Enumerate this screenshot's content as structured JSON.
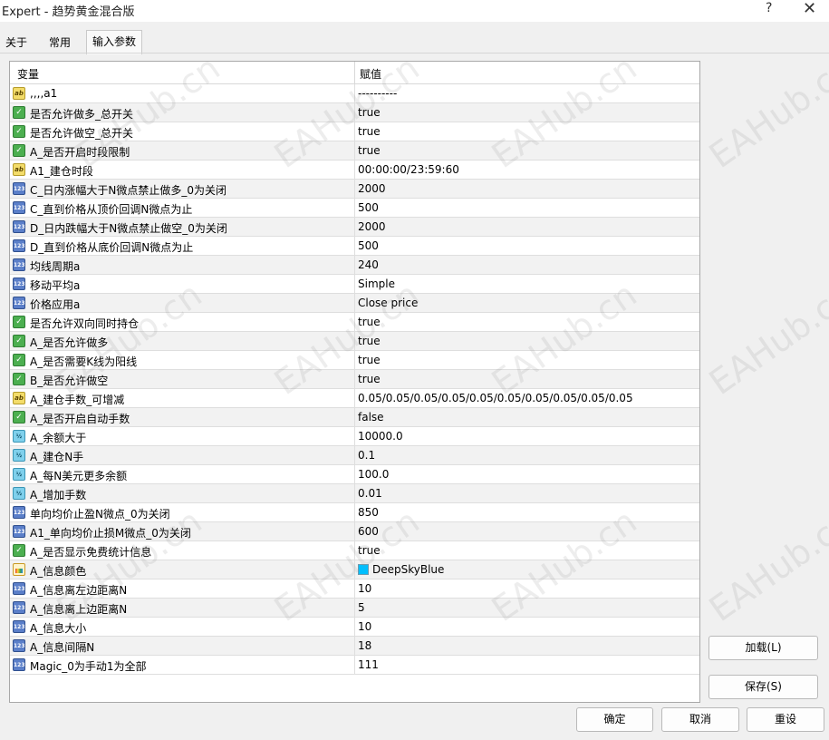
{
  "window": {
    "title": "Expert - 趋势黄金混合版",
    "help_glyph": "?",
    "close_glyph": "✕"
  },
  "tabs": [
    {
      "label": "关于"
    },
    {
      "label": "常用"
    },
    {
      "label": "输入参数",
      "active": true
    }
  ],
  "table": {
    "headers": {
      "variable": "变量",
      "value": "赋值"
    },
    "rows": [
      {
        "type": "string",
        "name": ",,,,a1",
        "value": "----------"
      },
      {
        "type": "bool",
        "name": "是否允许做多_总开关",
        "value": "true"
      },
      {
        "type": "bool",
        "name": "是否允许做空_总开关",
        "value": "true"
      },
      {
        "type": "bool",
        "name": "A_是否开启时段限制",
        "value": "true"
      },
      {
        "type": "string",
        "name": "A1_建仓时段",
        "value": "00:00:00/23:59:60"
      },
      {
        "type": "int",
        "name": "C_日内涨幅大于N微点禁止做多_0为关闭",
        "value": "2000"
      },
      {
        "type": "int",
        "name": "C_直到价格从顶价回调N微点为止",
        "value": "500"
      },
      {
        "type": "int",
        "name": "D_日内跌幅大于N微点禁止做空_0为关闭",
        "value": "2000"
      },
      {
        "type": "int",
        "name": "D_直到价格从底价回调N微点为止",
        "value": "500"
      },
      {
        "type": "int",
        "name": "均线周期a",
        "value": "240"
      },
      {
        "type": "int",
        "name": "移动平均a",
        "value": "Simple"
      },
      {
        "type": "int",
        "name": "价格应用a",
        "value": "Close price"
      },
      {
        "type": "bool",
        "name": "是否允许双向同时持仓",
        "value": "true"
      },
      {
        "type": "bool",
        "name": "A_是否允许做多",
        "value": "true"
      },
      {
        "type": "bool",
        "name": "A_是否需要K线为阳线",
        "value": "true"
      },
      {
        "type": "bool",
        "name": "B_是否允许做空",
        "value": "true"
      },
      {
        "type": "string",
        "name": "A_建仓手数_可增减",
        "value": "0.05/0.05/0.05/0.05/0.05/0.05/0.05/0.05/0.05/0.05"
      },
      {
        "type": "bool",
        "name": "A_是否开启自动手数",
        "value": "false"
      },
      {
        "type": "double",
        "name": "A_余额大于",
        "value": "10000.0"
      },
      {
        "type": "double",
        "name": "A_建仓N手",
        "value": "0.1"
      },
      {
        "type": "double",
        "name": "A_每N美元更多余额",
        "value": "100.0"
      },
      {
        "type": "double",
        "name": "A_增加手数",
        "value": "0.01"
      },
      {
        "type": "int",
        "name": "单向均价止盈N微点_0为关闭",
        "value": "850"
      },
      {
        "type": "int",
        "name": "A1_单向均价止损M微点_0为关闭",
        "value": "600"
      },
      {
        "type": "bool",
        "name": "A_是否显示免费统计信息",
        "value": "true"
      },
      {
        "type": "color",
        "name": "A_信息颜色",
        "value": "DeepSkyBlue",
        "swatch": "#00bfff"
      },
      {
        "type": "int",
        "name": "A_信息离左边距离N",
        "value": "10"
      },
      {
        "type": "int",
        "name": "A_信息离上边距离N",
        "value": "5"
      },
      {
        "type": "int",
        "name": "A_信息大小",
        "value": "10"
      },
      {
        "type": "int",
        "name": "A_信息间隔N",
        "value": "18"
      },
      {
        "type": "int",
        "name": "Magic_0为手动1为全部",
        "value": "111"
      }
    ]
  },
  "buttons": {
    "load": "加载(L)",
    "save": "保存(S)",
    "ok": "确定",
    "cancel": "取消",
    "reset": "重设"
  },
  "watermark": {
    "text": "EAHub.cn"
  }
}
